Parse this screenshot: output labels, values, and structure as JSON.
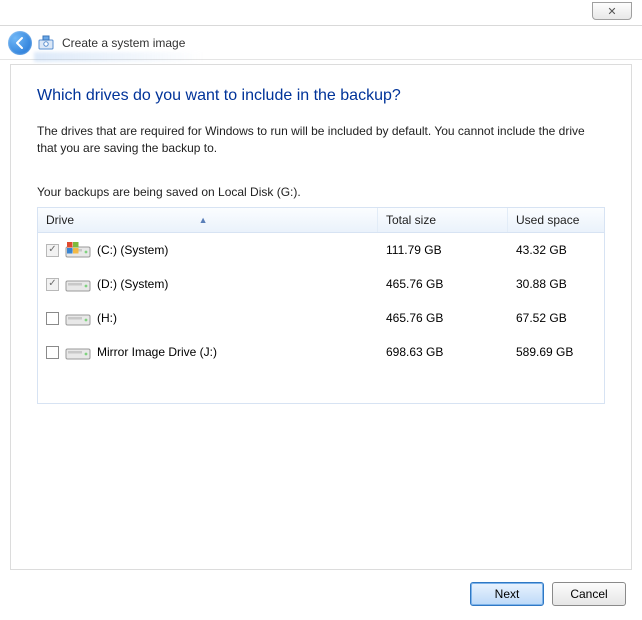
{
  "window": {
    "close_glyph": "✕"
  },
  "nav": {
    "title": "Create a system image"
  },
  "page": {
    "heading": "Which drives do you want to include in the backup?",
    "description": "The drives that are required for Windows to run will be included by default. You cannot include the drive that you are saving the backup to.",
    "saving_line": "Your backups are being saved on Local Disk (G:)."
  },
  "table": {
    "columns": {
      "drive": "Drive",
      "total": "Total size",
      "used": "Used space"
    },
    "sort_indicator": "▲",
    "rows": [
      {
        "checked": true,
        "disabled": true,
        "icon": "system",
        "label": "(C:) (System)",
        "total": "111.79 GB",
        "used": "43.32 GB"
      },
      {
        "checked": true,
        "disabled": true,
        "icon": "drive",
        "label": "(D:) (System)",
        "total": "465.76 GB",
        "used": "30.88 GB"
      },
      {
        "checked": false,
        "disabled": false,
        "icon": "drive",
        "label": "(H:)",
        "total": "465.76 GB",
        "used": "67.52 GB"
      },
      {
        "checked": false,
        "disabled": false,
        "icon": "drive",
        "label": "Mirror Image Drive (J:)",
        "total": "698.63 GB",
        "used": "589.69 GB"
      }
    ]
  },
  "actions": {
    "next": "Next",
    "cancel": "Cancel"
  }
}
